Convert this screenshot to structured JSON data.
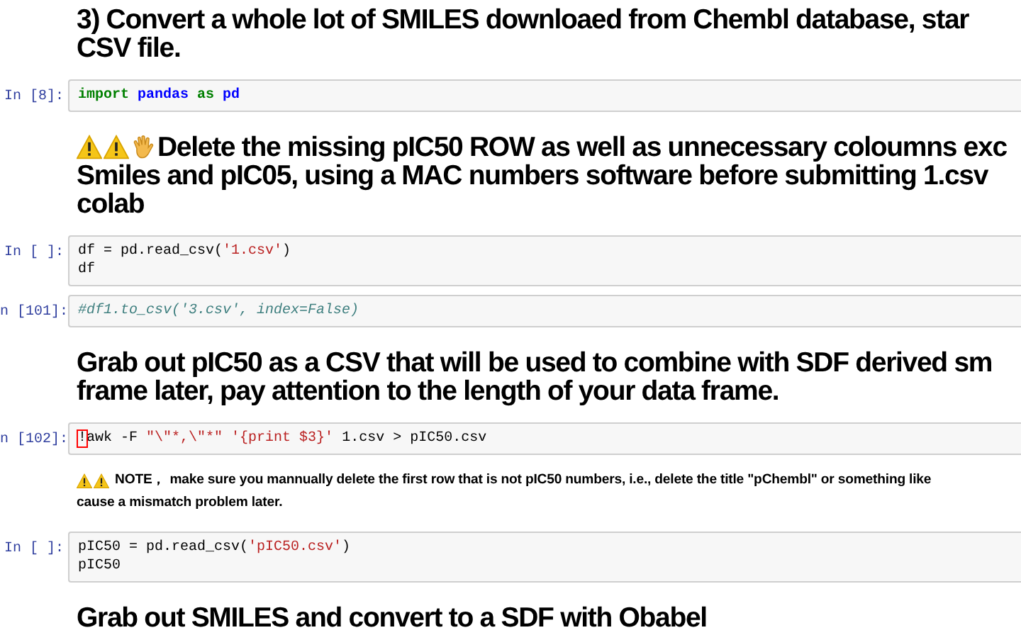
{
  "cells": [
    {
      "kind": "heading",
      "lines": [
        "3)   Convert a whole lot of SMILES downloaed from Chembl database, star",
        "CSV file."
      ]
    },
    {
      "kind": "code",
      "prompt": "In [8]:",
      "lines": [
        [
          {
            "kind": "keyword",
            "s": "import"
          },
          {
            "kind": "name",
            "s": " pandas"
          },
          {
            "kind": "keyword",
            "s": " as"
          },
          {
            "kind": "name",
            "s": " pd"
          }
        ]
      ]
    },
    {
      "kind": "heading",
      "icons": [
        {
          "kind": "warning"
        },
        {
          "kind": "warning"
        },
        {
          "kind": "hand"
        }
      ],
      "lines": [
        "Delete the missing pIC50 ROW as well as unnecessary coloumns exc",
        "Smiles and pIC05, using a MAC numbers software before submitting 1.csv",
        "colab"
      ]
    },
    {
      "kind": "code",
      "prompt": "In [ ]:",
      "lines": [
        [
          {
            "kind": "plain",
            "s": "df = pd.read_csv("
          },
          {
            "kind": "string",
            "s": "'1.csv'"
          },
          {
            "kind": "plain",
            "s": ")"
          }
        ],
        [
          {
            "kind": "plain",
            "s": "df"
          }
        ]
      ]
    },
    {
      "kind": "code",
      "prompt": "n [101]:",
      "lines": [
        [
          {
            "kind": "comment",
            "s": "#df1.to_csv('3.csv', index=False)"
          }
        ]
      ]
    },
    {
      "kind": "heading",
      "lines": [
        "Grab out pIC50 as a CSV that will be used to combine with SDF derived sm",
        "frame later, pay attention to the length of your data frame."
      ]
    },
    {
      "kind": "code",
      "prompt": "n [102]:",
      "lines": [
        [
          {
            "kind": "error",
            "s": "!"
          },
          {
            "kind": "plain",
            "s": "awk -F "
          },
          {
            "kind": "string",
            "s": "\"\\\"*,\\\"*\""
          },
          {
            "kind": "string",
            "s": " '{print $3}'"
          },
          {
            "kind": "plain",
            "s": " 1.csv > pIC50.csv"
          }
        ]
      ]
    },
    {
      "kind": "note",
      "icons": [
        {
          "kind": "warning"
        },
        {
          "kind": "warning"
        }
      ],
      "lines": [
        "NOTE，  make sure you mannually delete the first row that is not pIC50 numbers, i.e., delete the title \"pChembl\" or something like",
        "cause a mismatch problem later."
      ]
    },
    {
      "kind": "code",
      "prompt": "In [ ]:",
      "lines": [
        [
          {
            "kind": "plain",
            "s": "pIC50 = pd.read_csv("
          },
          {
            "kind": "string",
            "s": "'pIC50.csv'"
          },
          {
            "kind": "plain",
            "s": ")"
          }
        ],
        [
          {
            "kind": "plain",
            "s": "pIC50"
          }
        ]
      ]
    },
    {
      "kind": "heading",
      "lines": [
        "Grab out SMILES and convert to a SDF with Obabel"
      ]
    }
  ]
}
